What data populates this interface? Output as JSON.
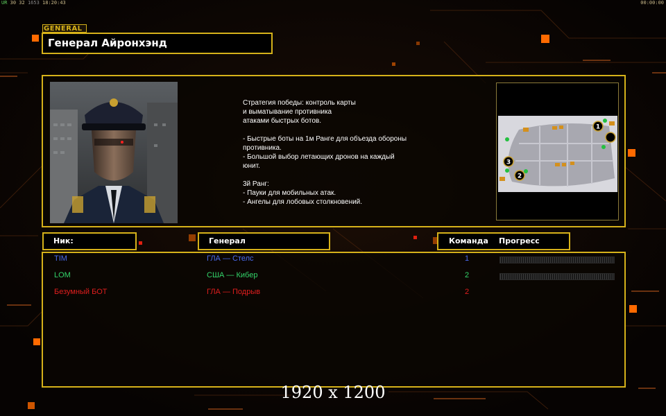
{
  "status_bar": {
    "left_code": "UR",
    "fps": "30 32",
    "frame": "1653",
    "time": "18:20:43",
    "timer_right": "00:00:00"
  },
  "general_tag": "GENERAL",
  "general_name": "Генерал Айронхэнд",
  "description": "Стратегия победы: контроль карты\nи выматывание противника\nатаками быстрых ботов.\n\n- Быстрые боты на 1м Ранге для объезда обороны\n противника.\n- Большой выбор летающих дронов на каждый\n юнит.\n\n3й Ранг:\n- Пауки для мобильных атак.\n- Ангелы для лобовых столкновений.",
  "minimap": {
    "start_positions": [
      "1",
      "2",
      "3"
    ]
  },
  "table_headers": {
    "nick": "Ник:",
    "general": "Генерал",
    "team": "Команда",
    "progress": "Прогресс"
  },
  "players": [
    {
      "nick": "TIM",
      "general": "ГЛА — Стелс",
      "team": "1",
      "color": "#4a6cf0",
      "progress": 0
    },
    {
      "nick": "LOM",
      "general": "США — Кибер",
      "team": "2",
      "color": "#33d46a",
      "progress": 0
    },
    {
      "nick": "Безумный БОТ",
      "general": "ГЛА — Подрыв",
      "team": "2",
      "color": "#e01e1e",
      "progress": null
    }
  ],
  "resolution_label": "1920 x 1200",
  "colors": {
    "accent_frame": "#d6b21a",
    "glow_orange": "#ff6a00"
  }
}
